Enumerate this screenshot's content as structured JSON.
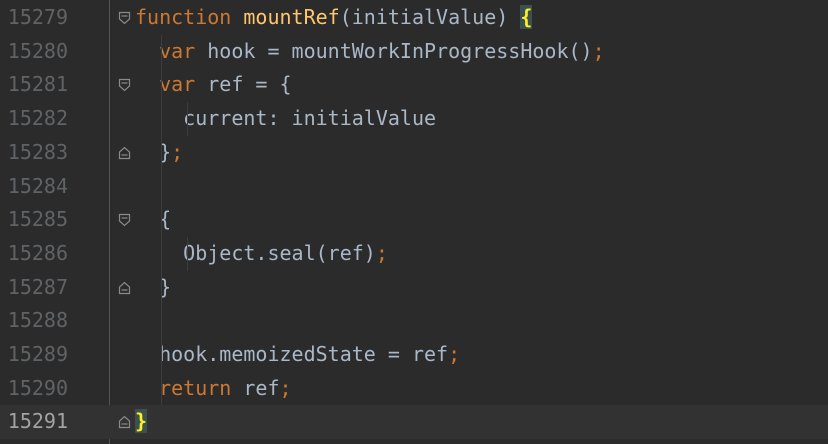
{
  "editor": {
    "lines": [
      {
        "number": "15279",
        "tokens": [
          {
            "t": "function",
            "c": "kw"
          },
          {
            "t": " ",
            "c": "sym"
          },
          {
            "t": "mountRef",
            "c": "fn"
          },
          {
            "t": "(initialValue) ",
            "c": "sym"
          },
          {
            "t": "{",
            "c": "brace-hl"
          }
        ],
        "fold": "start"
      },
      {
        "number": "15280",
        "tokens": [
          {
            "t": "  ",
            "c": "sym"
          },
          {
            "t": "var",
            "c": "kw"
          },
          {
            "t": " hook = mountWorkInProgressHook()",
            "c": "sym"
          },
          {
            "t": ";",
            "c": "semi"
          }
        ],
        "fold": ""
      },
      {
        "number": "15281",
        "tokens": [
          {
            "t": "  ",
            "c": "sym"
          },
          {
            "t": "var",
            "c": "kw"
          },
          {
            "t": " ref = {",
            "c": "sym"
          }
        ],
        "fold": "start"
      },
      {
        "number": "15282",
        "tokens": [
          {
            "t": "    ",
            "c": "sym"
          },
          {
            "t": "current",
            "c": "sym"
          },
          {
            "t": ": initialValue",
            "c": "sym"
          }
        ],
        "fold": ""
      },
      {
        "number": "15283",
        "tokens": [
          {
            "t": "  }",
            "c": "sym"
          },
          {
            "t": ";",
            "c": "semi"
          }
        ],
        "fold": "end"
      },
      {
        "number": "15284",
        "tokens": [],
        "fold": ""
      },
      {
        "number": "15285",
        "tokens": [
          {
            "t": "  {",
            "c": "sym"
          }
        ],
        "fold": "start"
      },
      {
        "number": "15286",
        "tokens": [
          {
            "t": "    Object.seal(ref)",
            "c": "sym"
          },
          {
            "t": ";",
            "c": "semi"
          }
        ],
        "fold": ""
      },
      {
        "number": "15287",
        "tokens": [
          {
            "t": "  }",
            "c": "sym"
          }
        ],
        "fold": "end"
      },
      {
        "number": "15288",
        "tokens": [],
        "fold": ""
      },
      {
        "number": "15289",
        "tokens": [
          {
            "t": "  hook.memoizedState = ref",
            "c": "sym"
          },
          {
            "t": ";",
            "c": "semi"
          }
        ],
        "fold": ""
      },
      {
        "number": "15290",
        "tokens": [
          {
            "t": "  ",
            "c": "sym"
          },
          {
            "t": "return",
            "c": "kw"
          },
          {
            "t": " ref",
            "c": "sym"
          },
          {
            "t": ";",
            "c": "semi"
          }
        ],
        "fold": ""
      },
      {
        "number": "15291",
        "tokens": [
          {
            "t": "}",
            "c": "brace-hl"
          }
        ],
        "fold": "end",
        "current": true
      }
    ]
  },
  "icons": {
    "fold_start": "fold-collapse-icon",
    "fold_end": "fold-end-icon"
  },
  "colors": {
    "background": "#2b2b2b",
    "current_line": "#323232",
    "keyword": "#cc7832",
    "function_name": "#ffc66d",
    "default_text": "#a9b7c6",
    "brace_match": "#ffef28",
    "line_number": "#606366"
  }
}
